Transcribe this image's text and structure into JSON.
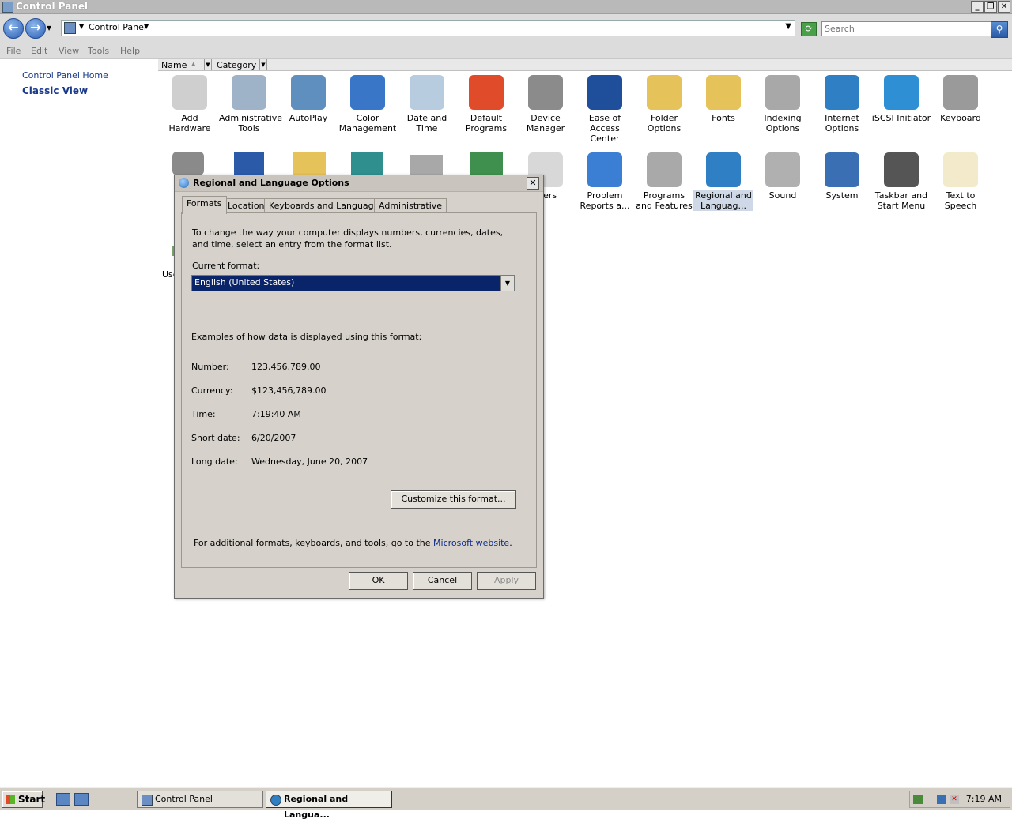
{
  "window": {
    "title": "Control Panel"
  },
  "address": {
    "crumb": "Control Panel",
    "search_placeholder": "Search"
  },
  "menu": [
    "File",
    "Edit",
    "View",
    "Tools",
    "Help"
  ],
  "leftpane": {
    "home": "Control Panel Home",
    "classic": "Classic View"
  },
  "columns": {
    "name": "Name",
    "category": "Category"
  },
  "items_row1": [
    {
      "label": "Add Hardware",
      "icon": "add-hardware-icon",
      "color": "#cfcfcf"
    },
    {
      "label": "Administrative Tools",
      "icon": "administrative-tools-icon",
      "color": "#9fb3c8"
    },
    {
      "label": "AutoPlay",
      "icon": "autoplay-icon",
      "color": "#5f8fbf"
    },
    {
      "label": "Color Management",
      "icon": "color-management-icon",
      "color": "#3a76c8"
    },
    {
      "label": "Date and Time",
      "icon": "date-time-icon",
      "color": "#b8cce0"
    },
    {
      "label": "Default Programs",
      "icon": "default-programs-icon",
      "color": "#e04b2a"
    },
    {
      "label": "Device Manager",
      "icon": "device-manager-icon",
      "color": "#8b8b8b"
    },
    {
      "label": "Ease of Access Center",
      "icon": "ease-of-access-icon",
      "color": "#1f4f9a"
    },
    {
      "label": "Folder Options",
      "icon": "folder-options-icon",
      "color": "#e6c25a"
    },
    {
      "label": "Fonts",
      "icon": "fonts-icon",
      "color": "#e6c25a"
    },
    {
      "label": "Indexing Options",
      "icon": "indexing-options-icon",
      "color": "#a8a8a8"
    },
    {
      "label": "Internet Options",
      "icon": "internet-options-icon",
      "color": "#2f7fc4"
    },
    {
      "label": "iSCSI Initiator",
      "icon": "iscsi-initiator-icon",
      "color": "#2f8fd4"
    },
    {
      "label": "Keyboard",
      "icon": "keyboard-icon",
      "color": "#9a9a9a"
    }
  ],
  "items_row2": [
    {
      "label": "nters",
      "icon": "printers-icon",
      "color": "#d8d8d8"
    },
    {
      "label": "Problem Reports a...",
      "icon": "problem-reports-icon",
      "color": "#3a7fd4"
    },
    {
      "label": "Programs and Features",
      "icon": "programs-features-icon",
      "color": "#a9a9a9"
    },
    {
      "label": "Regional and Languag...",
      "icon": "regional-language-icon",
      "color": "#2f7fc4"
    },
    {
      "label": "Sound",
      "icon": "sound-icon",
      "color": "#b0b0b0"
    },
    {
      "label": "System",
      "icon": "system-icon",
      "color": "#3a6fb4"
    },
    {
      "label": "Taskbar and Start Menu",
      "icon": "taskbar-start-menu-icon",
      "color": "#555555"
    },
    {
      "label": "Text to Speech",
      "icon": "text-to-speech-icon",
      "color": "#f2eacb"
    }
  ],
  "partial_item": {
    "label": "Use"
  },
  "dialog": {
    "title": "Regional and Language Options",
    "tabs": [
      "Formats",
      "Location",
      "Keyboards and Languages",
      "Administrative"
    ],
    "intro": "To change the way your computer displays numbers, currencies, dates, and time, select an entry from the format list.",
    "current_format_label": "Current format:",
    "current_format_value": "English (United States)",
    "examples_heading": "Examples of how data is displayed using this format:",
    "examples": [
      {
        "label": "Number:",
        "value": "123,456,789.00"
      },
      {
        "label": "Currency:",
        "value": "$123,456,789.00"
      },
      {
        "label": "Time:",
        "value": "7:19:40 AM"
      },
      {
        "label": "Short date:",
        "value": "6/20/2007"
      },
      {
        "label": "Long date:",
        "value": "Wednesday, June 20, 2007"
      }
    ],
    "customize_button": "Customize this format...",
    "footer_text": "For additional formats, keyboards, and tools, go to the",
    "footer_link": "Microsoft website",
    "footer_end": ".",
    "ok": "OK",
    "cancel": "Cancel",
    "apply": "Apply"
  },
  "taskbar": {
    "start": "Start",
    "tasks": [
      "Control Panel",
      "Regional and Langua..."
    ],
    "clock": "7:19 AM"
  }
}
